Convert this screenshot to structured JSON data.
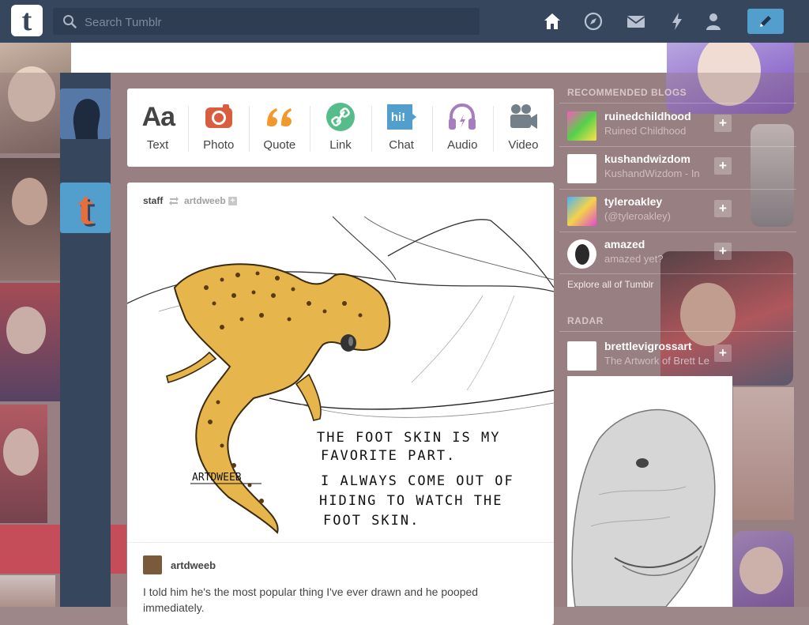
{
  "header": {
    "logo_letter": "t",
    "search_placeholder": "Search Tumblr",
    "nav_icons": [
      "home-icon",
      "compass-icon",
      "mail-icon",
      "lightning-icon",
      "person-icon",
      "pencil-icon"
    ]
  },
  "composer": {
    "types": [
      {
        "key": "text",
        "label": "Text",
        "glyph": "Aa",
        "color": "#444444"
      },
      {
        "key": "photo",
        "label": "Photo",
        "color": "#d95e40"
      },
      {
        "key": "quote",
        "label": "Quote",
        "color": "#f2992e"
      },
      {
        "key": "link",
        "label": "Link",
        "color": "#56bc8a"
      },
      {
        "key": "chat",
        "label": "Chat",
        "glyph": "hi!",
        "color": "#529ecc"
      },
      {
        "key": "audio",
        "label": "Audio",
        "color": "#a77dc2"
      },
      {
        "key": "video",
        "label": "Video",
        "color": "#748089"
      }
    ]
  },
  "post": {
    "author": "staff",
    "reblogged_from": "artdweeb",
    "art": {
      "lines": [
        "THE FOOT SKIN IS MY",
        "FAVORITE PART.",
        "I ALWAYS COME OUT OF",
        "HIDING TO WATCH THE",
        "FOOT SKIN."
      ],
      "signature": "ARTDWEEB"
    },
    "caption_author": "artdweeb",
    "caption_text": "I told him he's the most popular thing I've ever drawn and he pooped immediately."
  },
  "sidebar": {
    "recommended_title": "RECOMMENDED BLOGS",
    "recommended": [
      {
        "name": "ruinedchildhood",
        "subtitle": "Ruined Childhood"
      },
      {
        "name": "kushandwizdom",
        "subtitle": "KushandWizdom - In"
      },
      {
        "name": "tyleroakley",
        "subtitle": "(@tyleroakley)"
      },
      {
        "name": "amazed",
        "subtitle": "amazed yet?"
      }
    ],
    "explore_link": "Explore all of Tumblr",
    "radar_title": "RADAR",
    "radar": {
      "name": "brettlevigrossart",
      "subtitle": "The Artwork of Brett Le"
    }
  },
  "colors": {
    "header_bg": "#36465d",
    "accent": "#529ecc",
    "page_bg": "#9e8789"
  }
}
